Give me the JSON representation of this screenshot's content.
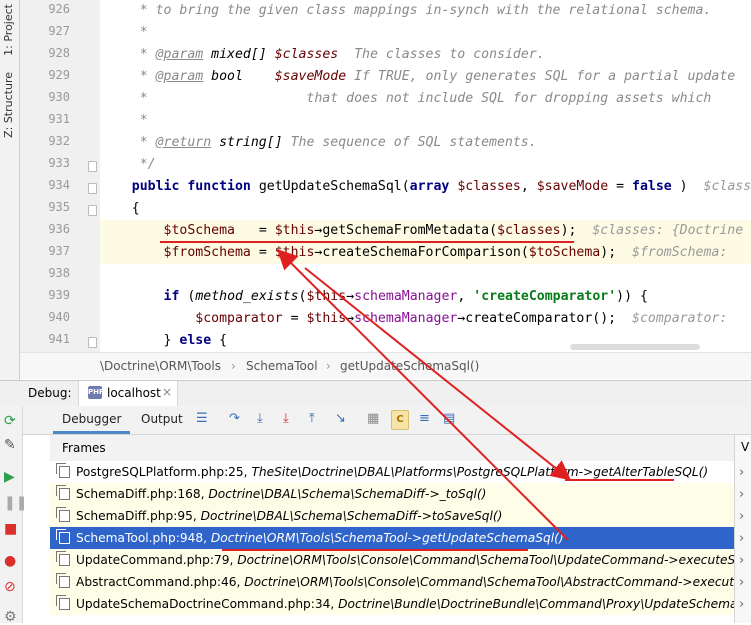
{
  "left_tabs": {
    "project": "1: Project",
    "structure": "Z: Structure"
  },
  "editor": {
    "line_numbers": [
      "926",
      "927",
      "928",
      "929",
      "930",
      "931",
      "932",
      "933",
      "934",
      "935",
      "936",
      "937",
      "938",
      "939",
      "940",
      "941"
    ],
    "lines": [
      {
        "seg": [
          [
            "cmt",
            "     * to bring the given class mappings in-synch with the relational schema."
          ]
        ]
      },
      {
        "seg": [
          [
            "cmt",
            "     *"
          ]
        ]
      },
      {
        "seg": [
          [
            "cmt",
            "     * "
          ],
          [
            "doctag",
            "@param"
          ],
          [
            "tp",
            " mixed[] "
          ],
          [
            "vital",
            "$classes"
          ],
          [
            "cmt",
            "  The classes to consider."
          ]
        ]
      },
      {
        "seg": [
          [
            "cmt",
            "     * "
          ],
          [
            "doctag",
            "@param"
          ],
          [
            "tp",
            " bool    "
          ],
          [
            "vital",
            "$saveMode"
          ],
          [
            "cmt",
            " If TRUE, only generates SQL for a partial update"
          ]
        ]
      },
      {
        "seg": [
          [
            "cmt",
            "     *                    that does not include SQL for dropping assets which"
          ]
        ]
      },
      {
        "seg": [
          [
            "cmt",
            "     *"
          ]
        ]
      },
      {
        "seg": [
          [
            "cmt",
            "     * "
          ],
          [
            "doctag",
            "@return"
          ],
          [
            "tp",
            " string[]"
          ],
          [
            "cmt",
            " The sequence of SQL statements."
          ]
        ]
      },
      {
        "seg": [
          [
            "cmt",
            "     */"
          ]
        ]
      },
      {
        "seg": [
          [
            "",
            "    "
          ],
          [
            "kw",
            "public function "
          ],
          [
            "",
            "getUpdateSchemaSql("
          ],
          [
            "kw",
            "array "
          ],
          [
            "var",
            "$classes"
          ],
          [
            "",
            ", "
          ],
          [
            "var",
            "$saveMode"
          ],
          [
            "",
            " = "
          ],
          [
            "kw",
            "false"
          ],
          [
            "",
            " )  "
          ],
          [
            "hint",
            "$classes"
          ]
        ]
      },
      {
        "seg": [
          [
            "",
            "    {"
          ]
        ]
      },
      {
        "seg": [
          [
            "",
            "        "
          ],
          [
            "var",
            "$toSchema"
          ],
          [
            "",
            "   = "
          ],
          [
            "var",
            "$this"
          ],
          [
            "",
            "→getSchemaFromMetadata("
          ],
          [
            "var",
            "$classes"
          ],
          [
            "",
            ");  "
          ],
          [
            "hint",
            "$classes: {Doctrine"
          ]
        ]
      },
      {
        "seg": [
          [
            "",
            "        "
          ],
          [
            "var",
            "$fromSchema"
          ],
          [
            "",
            " = "
          ],
          [
            "var",
            "$this"
          ],
          [
            "",
            "→createSchemaForComparison("
          ],
          [
            "var",
            "$toSchema"
          ],
          [
            "",
            ");  "
          ],
          [
            "hint",
            "$fromSchema:"
          ]
        ]
      },
      {
        "seg": [
          [
            "",
            ""
          ]
        ]
      },
      {
        "seg": [
          [
            "",
            "        "
          ],
          [
            "kw",
            "if "
          ],
          [
            "",
            "("
          ],
          [
            "fn",
            "method_exists"
          ],
          [
            "",
            "("
          ],
          [
            "var",
            "$this"
          ],
          [
            "",
            "→"
          ],
          [
            "mth",
            "schemaManager"
          ],
          [
            "",
            ", "
          ],
          [
            "str",
            "'createComparator'"
          ],
          [
            "",
            ")) {"
          ]
        ]
      },
      {
        "seg": [
          [
            "",
            "            "
          ],
          [
            "var",
            "$comparator"
          ],
          [
            "",
            " = "
          ],
          [
            "var",
            "$this"
          ],
          [
            "",
            "→"
          ],
          [
            "mth",
            "schemaManager"
          ],
          [
            "",
            "→createComparator();  "
          ],
          [
            "hint",
            "$comparator:"
          ]
        ]
      },
      {
        "seg": [
          [
            "",
            "        } "
          ],
          [
            "kw",
            "else "
          ],
          [
            "",
            "{"
          ]
        ]
      }
    ]
  },
  "breadcrumbs": [
    "\\Doctrine\\ORM\\Tools",
    "SchemaTool",
    "getUpdateSchemaSql()"
  ],
  "debug": {
    "label": "Debug:",
    "session": "localhost",
    "session_icon": "php-icon",
    "tabs": [
      "Debugger",
      "Output"
    ],
    "frames_header": "Frames",
    "vars_header": "V",
    "frames": [
      {
        "file": "PostgreSQLPlatform.php:25, ",
        "ctx": "TheSite\\Doctrine\\DBAL\\Platforms\\PostgreSQLPlatform->getAlterTableSQL()"
      },
      {
        "file": "SchemaDiff.php:168, ",
        "ctx": "Doctrine\\DBAL\\Schema\\SchemaDiff->_toSql()"
      },
      {
        "file": "SchemaDiff.php:95, ",
        "ctx": "Doctrine\\DBAL\\Schema\\SchemaDiff->toSaveSql()"
      },
      {
        "file": "SchemaTool.php:948, ",
        "ctx": "Doctrine\\ORM\\Tools\\SchemaTool->getUpdateSchemaSql()"
      },
      {
        "file": "UpdateCommand.php:79, ",
        "ctx": "Doctrine\\ORM\\Tools\\Console\\Command\\SchemaTool\\UpdateCommand->executeSchemaCommand()"
      },
      {
        "file": "AbstractCommand.php:46, ",
        "ctx": "Doctrine\\ORM\\Tools\\Console\\Command\\SchemaTool\\AbstractCommand->execute()"
      },
      {
        "file": "UpdateSchemaDoctrineCommand.php:34, ",
        "ctx": "Doctrine\\Bundle\\DoctrineBundle\\Command\\Proxy\\UpdateSchemaDoctrineCommand->execute()"
      }
    ],
    "selected_frame": 3
  },
  "colors": {
    "selection": "#2f65ca",
    "annotation": "#e02020",
    "execution_highlight": "#fdfbe3"
  }
}
